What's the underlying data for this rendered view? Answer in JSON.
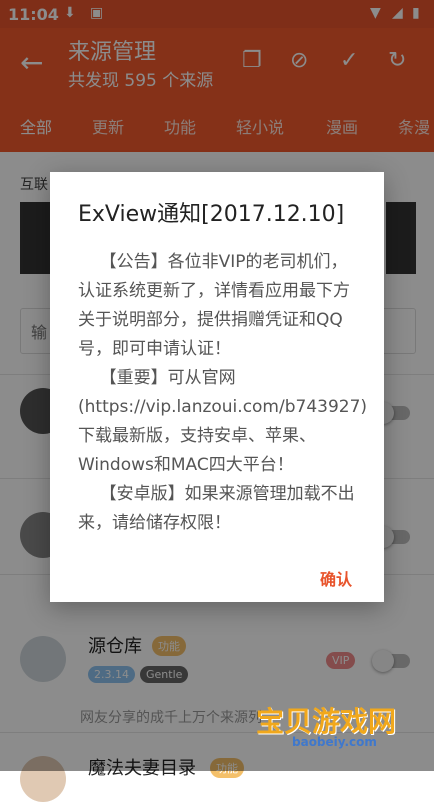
{
  "status": {
    "time": "11:04"
  },
  "appbar": {
    "title": "来源管理",
    "subtitle": "共发现 595 个来源"
  },
  "tabs": [
    "全部",
    "更新",
    "功能",
    "轻小说",
    "漫画",
    "条漫"
  ],
  "content": {
    "section_title": "互联",
    "search_placeholder": "输",
    "item3_name": "源仓库",
    "item3_tag": "功能",
    "item3_version": "2.3.14",
    "item3_author": "Gentle",
    "item3_vip": "VIP",
    "item3_desc": "网友分享的成千上万个来源列",
    "item4_name": "魔法夫妻目录",
    "item4_tag": "功能"
  },
  "dialog": {
    "title": "ExView通知[2017.12.10]",
    "body": "    【公告】各位非VIP的老司机们，认证系统更新了，详情看应用最下方关于说明部分，提供捐赠凭证和QQ号，即可申请认证！\n    【重要】可从官网(https://vip.lanzoui.com/b743927)下载最新版，支持安卓、苹果、Windows和MAC四大平台！\n    【安卓版】如果来源管理加载不出来，请给储存权限！",
    "confirm": "确认"
  },
  "watermark": {
    "main": "宝贝游戏网",
    "url": "baobeiy.com"
  }
}
